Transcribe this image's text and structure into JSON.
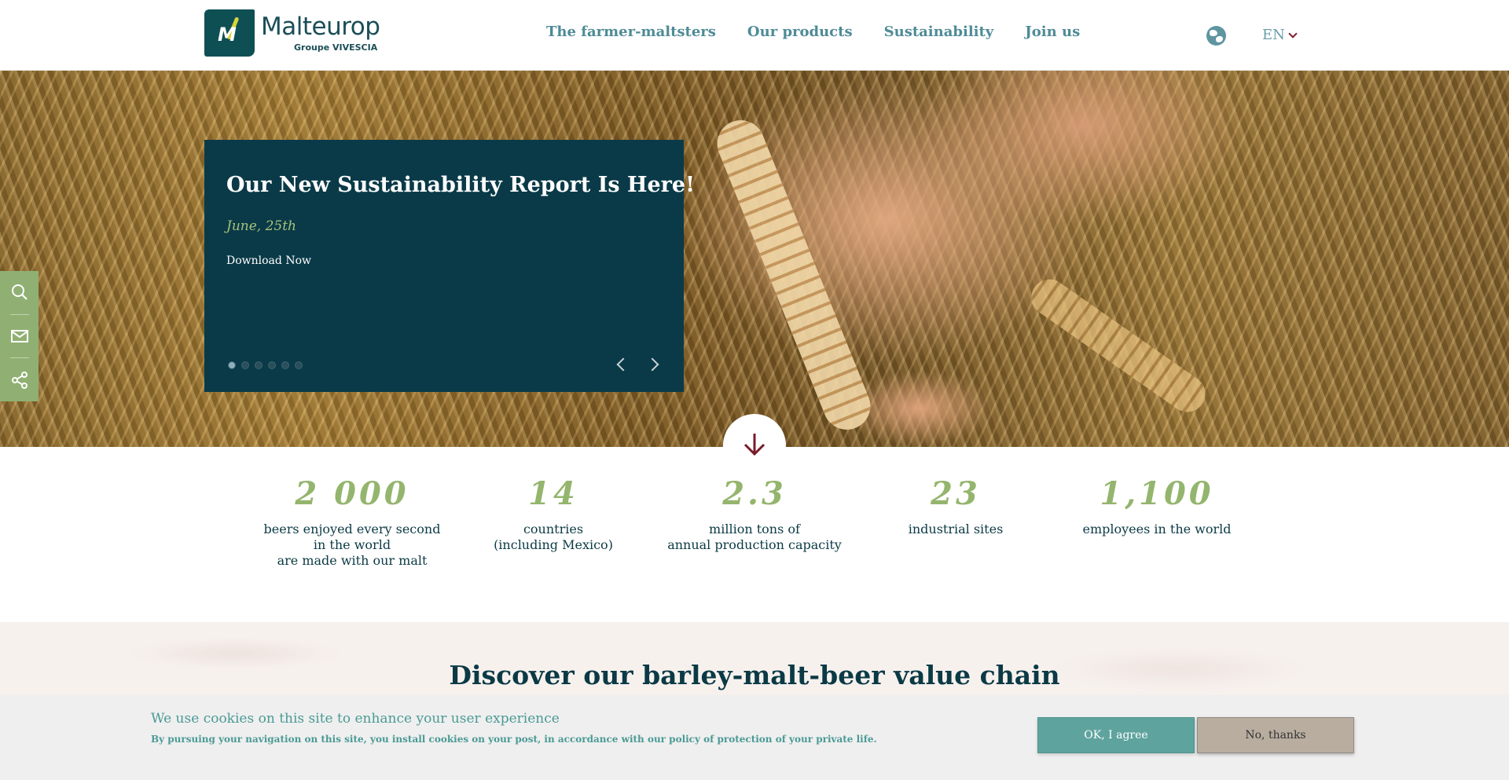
{
  "header": {
    "brand_name": "Malteurop",
    "brand_sub": "Groupe VIVESCIA",
    "logo_letter": "M",
    "nav": [
      {
        "label": "The farmer-maltsters"
      },
      {
        "label": "Our products"
      },
      {
        "label": "Sustainability"
      },
      {
        "label": "Join us"
      }
    ],
    "language": "EN",
    "globe_icon": "globe-icon"
  },
  "hero": {
    "slide": {
      "title": "Our New Sustainability Report Is Here!",
      "date": "June, 25th",
      "link": "Download Now"
    },
    "slide_count": 6,
    "active_slide": 1,
    "scroll_icon": "arrow-down-icon"
  },
  "sidebar": {
    "items": [
      {
        "icon": "search-icon"
      },
      {
        "icon": "mail-icon"
      },
      {
        "icon": "share-icon"
      }
    ]
  },
  "stats": [
    {
      "value": "2 000",
      "label": "beers enjoyed every second\nin the world\nare made with our malt"
    },
    {
      "value": "14",
      "label": "countries\n(including Mexico)"
    },
    {
      "value": "2.3",
      "label": "million tons of\nannual production capacity"
    },
    {
      "value": "23",
      "label": "industrial sites"
    },
    {
      "value": "1,100",
      "label": "employees in the world"
    }
  ],
  "discover": {
    "title": "Discover our barley-malt-beer value chain"
  },
  "cookie": {
    "title": "We use cookies on this site to enhance your user experience",
    "text": "By pursuing your navigation on this site, you install cookies on your post, in accordance with our policy of protection of your private life.",
    "agree_label": "OK, I agree",
    "decline_label": "No, thanks"
  },
  "colors": {
    "primary": "#0a3a48",
    "accent_green": "#94b56d",
    "nav_teal": "#4e8b97",
    "cookie_teal": "#5fa39e",
    "dark_red": "#7a1b2a"
  }
}
